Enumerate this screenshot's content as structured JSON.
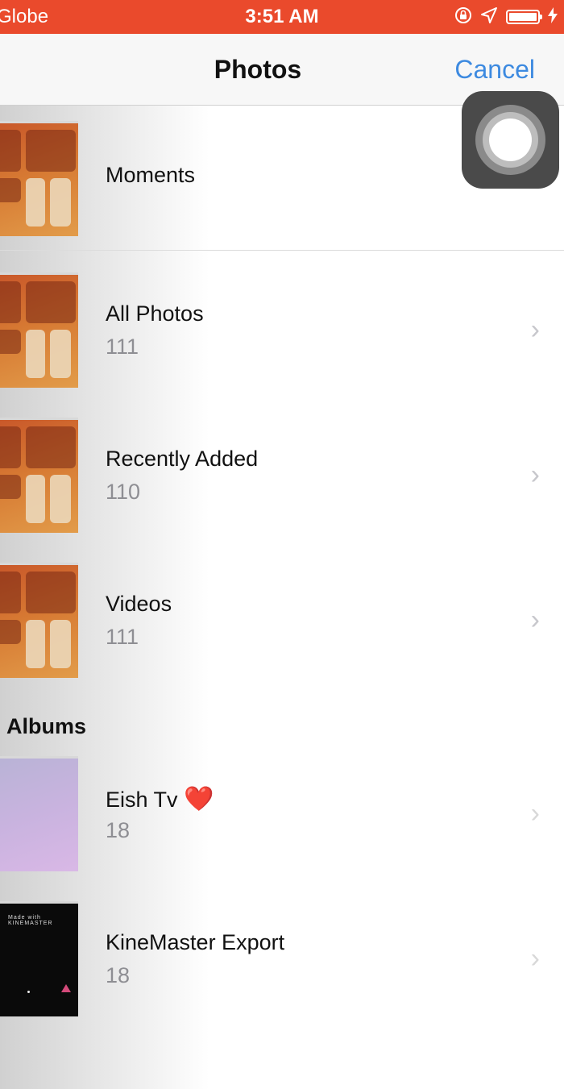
{
  "status_bar": {
    "carrier": "Globe",
    "time": "3:51 AM"
  },
  "nav": {
    "title": "Photos",
    "cancel": "Cancel"
  },
  "icons": {
    "orientation_lock": "orientation-lock-icon",
    "location": "location-arrow-icon",
    "battery": "battery-icon",
    "charging": "bolt-icon",
    "chevron": "chevron-right-icon"
  },
  "smart_albums": [
    {
      "title": "Moments"
    },
    {
      "title": "All Photos",
      "count": "111"
    },
    {
      "title": "Recently Added",
      "count": "110"
    },
    {
      "title": "Videos",
      "count": "111"
    }
  ],
  "albums_header": "Albums",
  "albums": [
    {
      "title": "Eish Tv",
      "emoji": "❤️",
      "count": "18"
    },
    {
      "title": "KineMaster Export",
      "count": "18",
      "thumb_text": "Made with KINEMASTER"
    }
  ],
  "colors": {
    "status_bar": "#ea4a2c",
    "accent": "#3d8ae0",
    "count_gray": "#8e8e93",
    "chevron_gray": "#c7c7cc"
  }
}
